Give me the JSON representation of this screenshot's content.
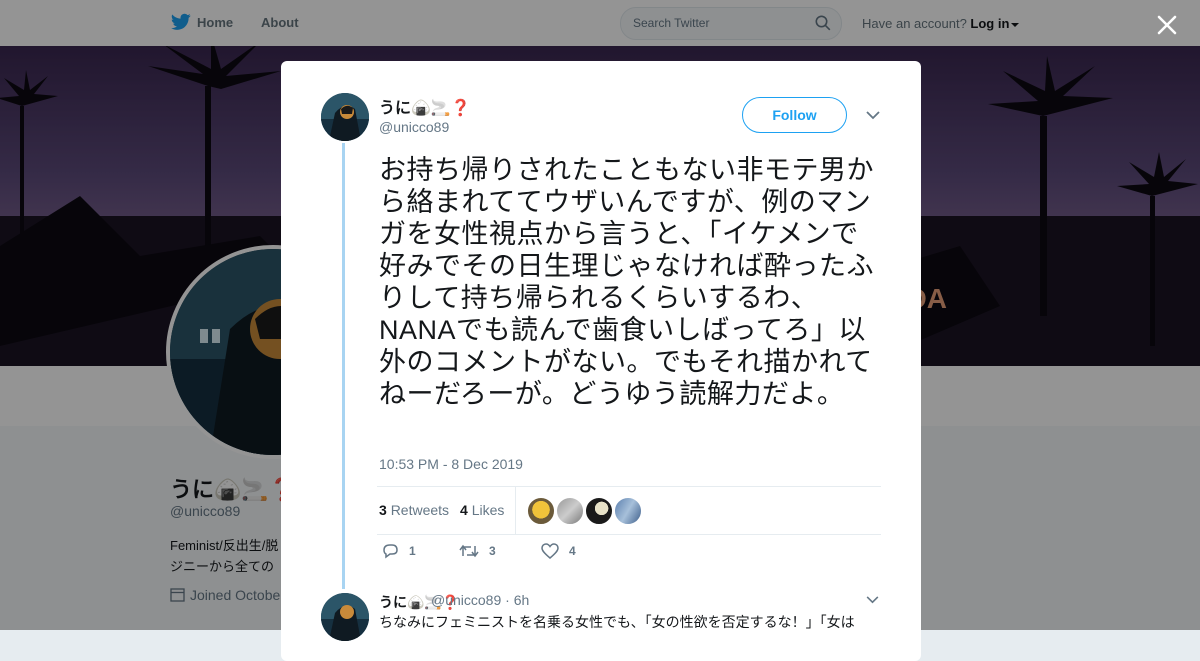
{
  "nav": {
    "home": "Home",
    "about": "About",
    "search_placeholder": "Search Twitter",
    "have_account": "Have an account?",
    "login": "Log in"
  },
  "profile": {
    "name": "うに🍙🚬❓",
    "handle": "@unicco89",
    "bio": "Feminist/反出生/脱ジニーから全ての",
    "joined": "Joined October"
  },
  "tweet": {
    "name": "うに🍙🚬❓",
    "handle": "@unicco89",
    "follow_label": "Follow",
    "text": "お持ち帰りされたこともない非モテ男から絡まれててウザいんですが、例のマンガを女性視点から言うと、「イケメンで好みでその日生理じゃなければ酔ったふりして持ち帰られるくらいするわ、NANAでも読んで歯食いしばってろ」以外のコメントがない。でもそれ描かれてねーだろーが。どうゆう読解力だよ。",
    "timestamp": "10:53 PM - 8 Dec 2019",
    "retweets_count": "3",
    "retweets_label": "Retweets",
    "likes_count": "4",
    "likes_label": "Likes",
    "reply_count": "1",
    "retweet_action_count": "3",
    "like_action_count": "4"
  },
  "reply": {
    "name": "うに🍙🚬❓",
    "handle": "@unicco89",
    "time": "· 6h",
    "text": "ちなみにフェミニストを名乗る女性でも、「女の性欲を否定するな！」「女は"
  },
  "colors": {
    "twitter_blue": "#1da1f2",
    "thread_line": "#a8d4f2",
    "text_secondary": "#657786"
  },
  "icons": [
    "twitter-bird-icon",
    "search-icon",
    "caret-down-icon",
    "close-icon",
    "chevron-down-icon",
    "reply-icon",
    "retweet-icon",
    "heart-icon"
  ]
}
